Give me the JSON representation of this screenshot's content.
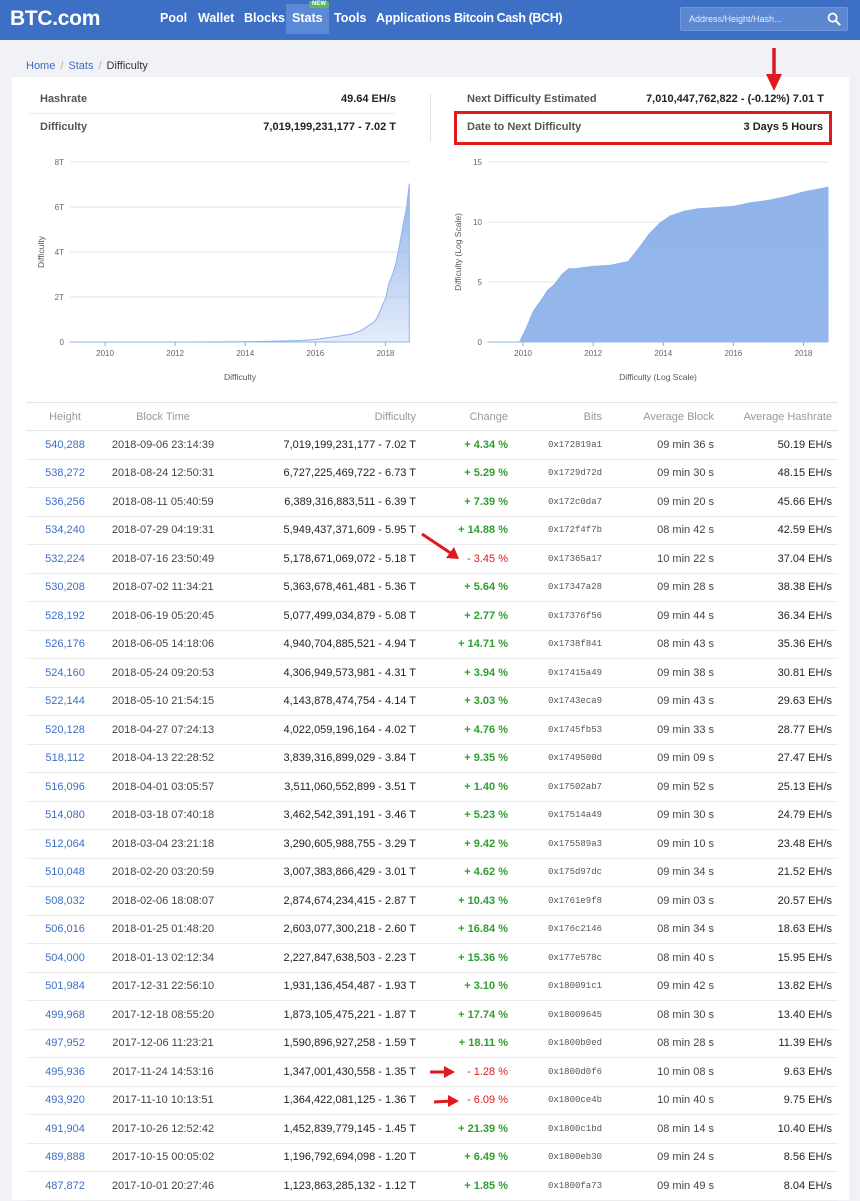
{
  "header": {
    "logo": "BTC.com",
    "nav": [
      {
        "label": "Pool",
        "active": false
      },
      {
        "label": "Wallet",
        "active": false
      },
      {
        "label": "Blocks",
        "active": false
      },
      {
        "label": "Stats",
        "active": true,
        "badge": "NEW"
      },
      {
        "label": "Tools",
        "active": false
      },
      {
        "label": "Applications",
        "active": false
      },
      {
        "label": "Bitcoin Cash (BCH)",
        "active": false
      }
    ],
    "search_placeholder": "Address/Height/Hash...",
    "search_icon": "search-icon"
  },
  "breadcrumb": {
    "home": "Home",
    "stats": "Stats",
    "current": "Difficulty"
  },
  "summary": {
    "hashrate_label": "Hashrate",
    "hashrate_value": "49.64 EH/s",
    "difficulty_label": "Difficulty",
    "difficulty_value": "7,019,199,231,177 - 7.02 T",
    "next_label": "Next Difficulty Estimated",
    "next_value": "7,010,447,762,822 - (-0.12%) 7.01 T",
    "date_label": "Date to Next Difficulty",
    "date_value": "3 Days 5 Hours"
  },
  "colors": {
    "header": "#3d6fc4",
    "link": "#3d6fc4",
    "positive": "#2e9e2e",
    "negative": "#e0191e",
    "area_fill": "#8fb3ea",
    "annotation": "#e0191e"
  },
  "chart_data": [
    {
      "type": "area",
      "xlabel": "Difficulty",
      "ylabel": "Difficulty",
      "x_ticks": [
        "2010",
        "2012",
        "2014",
        "2016",
        "2018"
      ],
      "y_ticks": [
        "0",
        "2T",
        "4T",
        "6T",
        "8T"
      ],
      "xlim": [
        2009,
        2018.7
      ],
      "ylim": [
        0,
        8
      ],
      "grid": true,
      "series": [
        {
          "values_unit": "T",
          "x": [
            2009.0,
            2012.0,
            2014.0,
            2015.5,
            2016.0,
            2016.5,
            2017.0,
            2017.3,
            2017.5,
            2017.7,
            2017.8,
            2017.9,
            2018.0,
            2018.1,
            2018.2,
            2018.3,
            2018.4,
            2018.5,
            2018.6,
            2018.68
          ],
          "y": [
            0.0,
            0.0,
            0.01,
            0.06,
            0.11,
            0.22,
            0.34,
            0.5,
            0.71,
            0.92,
            1.19,
            1.59,
            1.93,
            2.6,
            3.0,
            3.5,
            4.3,
            5.18,
            5.95,
            7.02
          ]
        }
      ]
    },
    {
      "type": "area",
      "xlabel": "Difficulty (Log Scale)",
      "ylabel": "Difficulty (Log Scale)",
      "x_ticks": [
        "2010",
        "2012",
        "2014",
        "2016",
        "2018"
      ],
      "y_ticks": [
        "0",
        "5",
        "10",
        "15"
      ],
      "xlim": [
        2009,
        2018.7
      ],
      "ylim": [
        0,
        15
      ],
      "grid": true,
      "series": [
        {
          "x": [
            2009.0,
            2009.9,
            2010.1,
            2010.3,
            2010.5,
            2010.7,
            2010.9,
            2011.1,
            2011.3,
            2011.5,
            2011.7,
            2012.0,
            2012.5,
            2013.0,
            2013.3,
            2013.6,
            2013.9,
            2014.2,
            2014.6,
            2015.0,
            2015.5,
            2016.0,
            2016.5,
            2017.0,
            2017.5,
            2018.0,
            2018.7
          ],
          "y": [
            0.0,
            0.0,
            1.2,
            2.6,
            3.4,
            4.3,
            4.8,
            5.6,
            6.1,
            6.1,
            6.2,
            6.3,
            6.4,
            6.7,
            7.8,
            9.0,
            9.9,
            10.5,
            10.9,
            11.1,
            11.2,
            11.3,
            11.6,
            11.8,
            12.1,
            12.5,
            12.9
          ]
        }
      ]
    }
  ],
  "table": {
    "headers": [
      "Height",
      "Block Time",
      "Difficulty",
      "Change",
      "Bits",
      "Average Block",
      "Average Hashrate"
    ],
    "rows": [
      {
        "height": "540,288",
        "time": "2018-09-06 23:14:39",
        "difficulty": "7,019,199,231,177 - 7.02 T",
        "change": "+ 4.34 %",
        "bits": "0x172819a1",
        "avg_block": "09 min 36 s",
        "hashrate": "50.19 EH/s"
      },
      {
        "height": "538,272",
        "time": "2018-08-24 12:50:31",
        "difficulty": "6,727,225,469,722 - 6.73 T",
        "change": "+ 5.29 %",
        "bits": "0x1729d72d",
        "avg_block": "09 min 30 s",
        "hashrate": "48.15 EH/s"
      },
      {
        "height": "536,256",
        "time": "2018-08-11 05:40:59",
        "difficulty": "6,389,316,883,511 - 6.39 T",
        "change": "+ 7.39 %",
        "bits": "0x172c0da7",
        "avg_block": "09 min 20 s",
        "hashrate": "45.66 EH/s"
      },
      {
        "height": "534,240",
        "time": "2018-07-29 04:19:31",
        "difficulty": "5,949,437,371,609 - 5.95 T",
        "change": "+ 14.88 %",
        "bits": "0x172f4f7b",
        "avg_block": "08 min 42 s",
        "hashrate": "42.59 EH/s"
      },
      {
        "height": "532,224",
        "time": "2018-07-16 23:50:49",
        "difficulty": "5,178,671,069,072 - 5.18 T",
        "change": "- 3.45 %",
        "bits": "0x17365a17",
        "avg_block": "10 min 22 s",
        "hashrate": "37.04 EH/s"
      },
      {
        "height": "530,208",
        "time": "2018-07-02 11:34:21",
        "difficulty": "5,363,678,461,481 - 5.36 T",
        "change": "+ 5.64 %",
        "bits": "0x17347a28",
        "avg_block": "09 min 28 s",
        "hashrate": "38.38 EH/s"
      },
      {
        "height": "528,192",
        "time": "2018-06-19 05:20:45",
        "difficulty": "5,077,499,034,879 - 5.08 T",
        "change": "+ 2.77 %",
        "bits": "0x17376f56",
        "avg_block": "09 min 44 s",
        "hashrate": "36.34 EH/s"
      },
      {
        "height": "526,176",
        "time": "2018-06-05 14:18:06",
        "difficulty": "4,940,704,885,521 - 4.94 T",
        "change": "+ 14.71 %",
        "bits": "0x1738f841",
        "avg_block": "08 min 43 s",
        "hashrate": "35.36 EH/s"
      },
      {
        "height": "524,160",
        "time": "2018-05-24 09:20:53",
        "difficulty": "4,306,949,573,981 - 4.31 T",
        "change": "+ 3.94 %",
        "bits": "0x17415a49",
        "avg_block": "09 min 38 s",
        "hashrate": "30.81 EH/s"
      },
      {
        "height": "522,144",
        "time": "2018-05-10 21:54:15",
        "difficulty": "4,143,878,474,754 - 4.14 T",
        "change": "+ 3.03 %",
        "bits": "0x1743eca9",
        "avg_block": "09 min 43 s",
        "hashrate": "29.63 EH/s"
      },
      {
        "height": "520,128",
        "time": "2018-04-27 07:24:13",
        "difficulty": "4,022,059,196,164 - 4.02 T",
        "change": "+ 4.76 %",
        "bits": "0x1745fb53",
        "avg_block": "09 min 33 s",
        "hashrate": "28.77 EH/s"
      },
      {
        "height": "518,112",
        "time": "2018-04-13 22:28:52",
        "difficulty": "3,839,316,899,029 - 3.84 T",
        "change": "+ 9.35 %",
        "bits": "0x1749500d",
        "avg_block": "09 min 09 s",
        "hashrate": "27.47 EH/s"
      },
      {
        "height": "516,096",
        "time": "2018-04-01 03:05:57",
        "difficulty": "3,511,060,552,899 - 3.51 T",
        "change": "+ 1.40 %",
        "bits": "0x17502ab7",
        "avg_block": "09 min 52 s",
        "hashrate": "25.13 EH/s"
      },
      {
        "height": "514,080",
        "time": "2018-03-18 07:40:18",
        "difficulty": "3,462,542,391,191 - 3.46 T",
        "change": "+ 5.23 %",
        "bits": "0x17514a49",
        "avg_block": "09 min 30 s",
        "hashrate": "24.79 EH/s"
      },
      {
        "height": "512,064",
        "time": "2018-03-04 23:21:18",
        "difficulty": "3,290,605,988,755 - 3.29 T",
        "change": "+ 9.42 %",
        "bits": "0x175589a3",
        "avg_block": "09 min 10 s",
        "hashrate": "23.48 EH/s"
      },
      {
        "height": "510,048",
        "time": "2018-02-20 03:20:59",
        "difficulty": "3,007,383,866,429 - 3.01 T",
        "change": "+ 4.62 %",
        "bits": "0x175d97dc",
        "avg_block": "09 min 34 s",
        "hashrate": "21.52 EH/s"
      },
      {
        "height": "508,032",
        "time": "2018-02-06 18:08:07",
        "difficulty": "2,874,674,234,415 - 2.87 T",
        "change": "+ 10.43 %",
        "bits": "0x1761e9f8",
        "avg_block": "09 min 03 s",
        "hashrate": "20.57 EH/s"
      },
      {
        "height": "506,016",
        "time": "2018-01-25 01:48:20",
        "difficulty": "2,603,077,300,218 - 2.60 T",
        "change": "+ 16.84 %",
        "bits": "0x176c2146",
        "avg_block": "08 min 34 s",
        "hashrate": "18.63 EH/s"
      },
      {
        "height": "504,000",
        "time": "2018-01-13 02:12:34",
        "difficulty": "2,227,847,638,503 - 2.23 T",
        "change": "+ 15.36 %",
        "bits": "0x177e578c",
        "avg_block": "08 min 40 s",
        "hashrate": "15.95 EH/s"
      },
      {
        "height": "501,984",
        "time": "2017-12-31 22:56:10",
        "difficulty": "1,931,136,454,487 - 1.93 T",
        "change": "+ 3.10 %",
        "bits": "0x180091c1",
        "avg_block": "09 min 42 s",
        "hashrate": "13.82 EH/s"
      },
      {
        "height": "499,968",
        "time": "2017-12-18 08:55:20",
        "difficulty": "1,873,105,475,221 - 1.87 T",
        "change": "+ 17.74 %",
        "bits": "0x18009645",
        "avg_block": "08 min 30 s",
        "hashrate": "13.40 EH/s"
      },
      {
        "height": "497,952",
        "time": "2017-12-06 11:23:21",
        "difficulty": "1,590,896,927,258 - 1.59 T",
        "change": "+ 18.11 %",
        "bits": "0x1800b0ed",
        "avg_block": "08 min 28 s",
        "hashrate": "11.39 EH/s"
      },
      {
        "height": "495,936",
        "time": "2017-11-24 14:53:16",
        "difficulty": "1,347,001,430,558 - 1.35 T",
        "change": "- 1.28 %",
        "bits": "0x1800d0f6",
        "avg_block": "10 min 08 s",
        "hashrate": "9.63 EH/s"
      },
      {
        "height": "493,920",
        "time": "2017-11-10 10:13:51",
        "difficulty": "1,364,422,081,125 - 1.36 T",
        "change": "- 6.09 %",
        "bits": "0x1800ce4b",
        "avg_block": "10 min 40 s",
        "hashrate": "9.75 EH/s"
      },
      {
        "height": "491,904",
        "time": "2017-10-26 12:52:42",
        "difficulty": "1,452,839,779,145 - 1.45 T",
        "change": "+ 21.39 %",
        "bits": "0x1800c1bd",
        "avg_block": "08 min 14 s",
        "hashrate": "10.40 EH/s"
      },
      {
        "height": "489,888",
        "time": "2017-10-15 00:05:02",
        "difficulty": "1,196,792,694,098 - 1.20 T",
        "change": "+ 6.49 %",
        "bits": "0x1800eb30",
        "avg_block": "09 min 24 s",
        "hashrate": "8.56 EH/s"
      },
      {
        "height": "487,872",
        "time": "2017-10-01 20:27:46",
        "difficulty": "1,123,863,285,132 - 1.12 T",
        "change": "+ 1.85 %",
        "bits": "0x1800fa73",
        "avg_block": "09 min 49 s",
        "hashrate": "8.04 EH/s"
      }
    ]
  }
}
